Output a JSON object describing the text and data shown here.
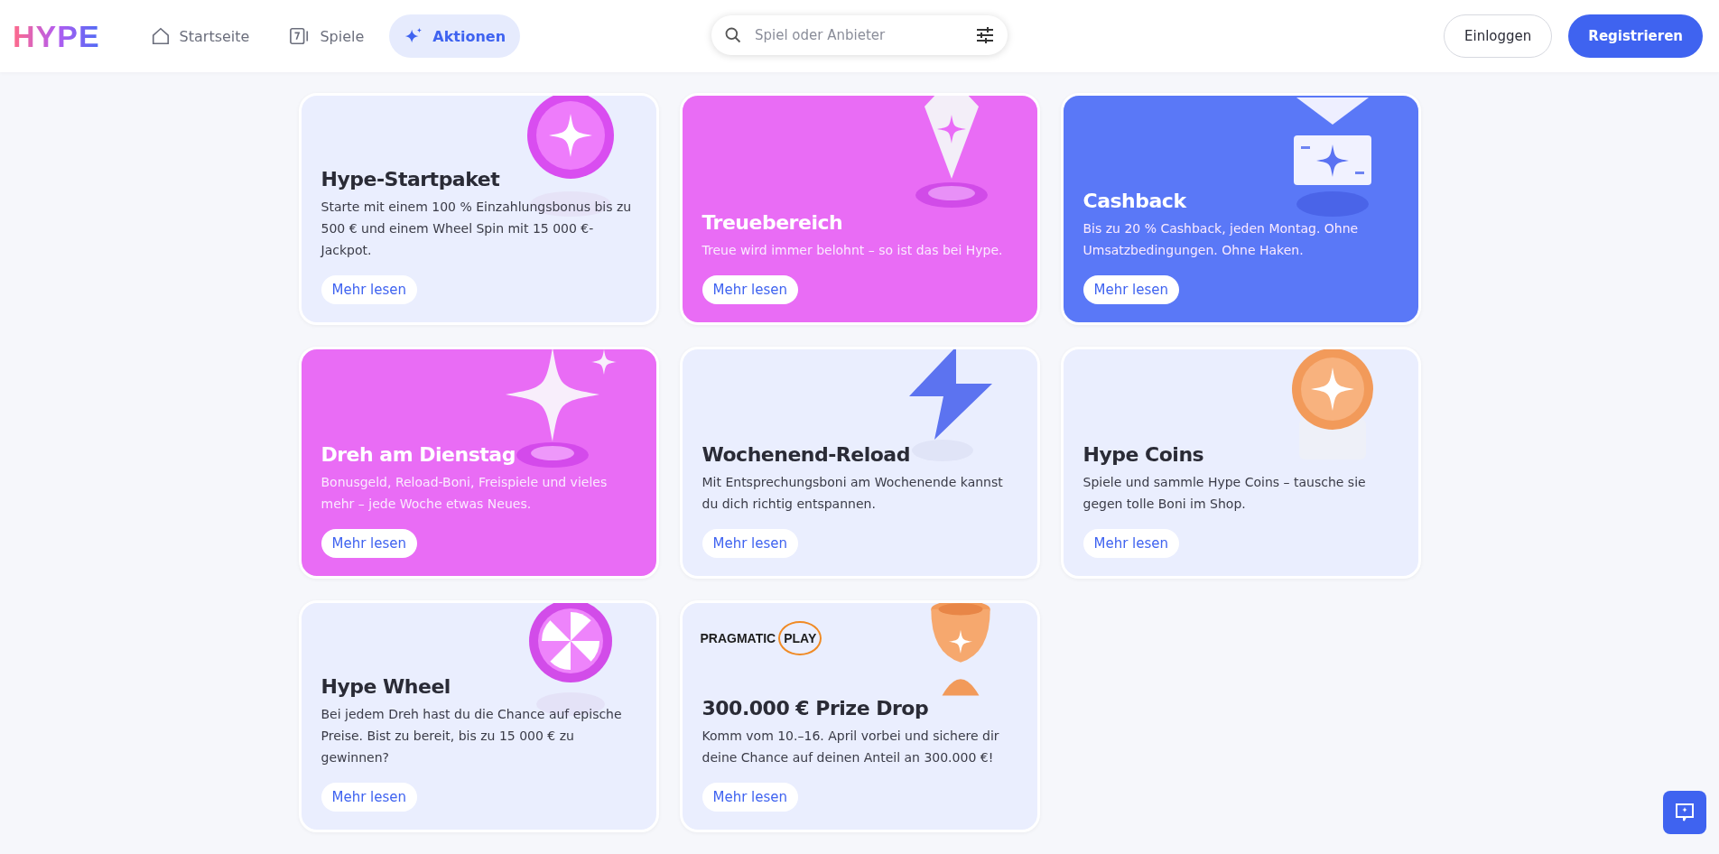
{
  "header": {
    "logo": "HYPE",
    "nav": [
      {
        "label": "Startseite",
        "selected": false
      },
      {
        "label": "Spiele",
        "selected": false
      },
      {
        "label": "Aktionen",
        "selected": true
      }
    ],
    "search": {
      "placeholder": "Spiel oder Anbieter"
    },
    "buttons": [
      {
        "label": "Einloggen",
        "kind": "outline"
      },
      {
        "label": "Registrieren",
        "kind": "primary"
      }
    ]
  },
  "promotions": [
    {
      "title": "Hype-Startpaket",
      "text": "Starte mit einem 100 % Einzahlungsbonus bis zu 500 € und einem Wheel Spin mit 15 000 €-Jackpot.",
      "button": "Mehr lesen",
      "color": "#eaeefe"
    },
    {
      "title": "Treuebereich",
      "text": "Treue wird immer belohnt – so ist das bei Hype.",
      "button": "Mehr lesen",
      "color": "#e96cf5"
    },
    {
      "title": "Cashback",
      "text": "Bis zu 20 % Cashback, jeden Montag. Ohne Umsatzbedingungen. Ohne Haken.",
      "button": "Mehr lesen",
      "color": "#5a78f7"
    },
    {
      "title": "Dreh am Dienstag",
      "text": "Bonusgeld, Reload-Boni, Freispiele und vieles mehr – jede Woche etwas Neues.",
      "button": "Mehr lesen",
      "color": "#e96cf5"
    },
    {
      "title": "Wochenend-Reload",
      "text": "Mit Entsprechungsboni am Wochenende kannst du dich richtig entspannen.",
      "button": "Mehr lesen",
      "color": "#eaeefe"
    },
    {
      "title": "Hype Coins",
      "text": "Spiele und sammle Hype Coins – tausche sie gegen tolle Boni im Shop.",
      "button": "Mehr lesen",
      "color": "#eaeefe"
    },
    {
      "title": "Hype Wheel",
      "text": "Bei jedem Dreh hast du die Chance auf epische Preise. Bist zu bereit, bis zu 15 000 € zu gewinnen?",
      "button": "Mehr lesen",
      "color": "#eaeefe"
    },
    {
      "title": "300.000 € Prize Drop",
      "text": "Komm vom 10.–16. April vorbei und sichere dir deine Chance auf deinen Anteil an 300.000 €!",
      "button": "Mehr lesen",
      "color": "#eaeefe",
      "partner": [
        "PRAGMATIC",
        "PLAY"
      ]
    }
  ]
}
